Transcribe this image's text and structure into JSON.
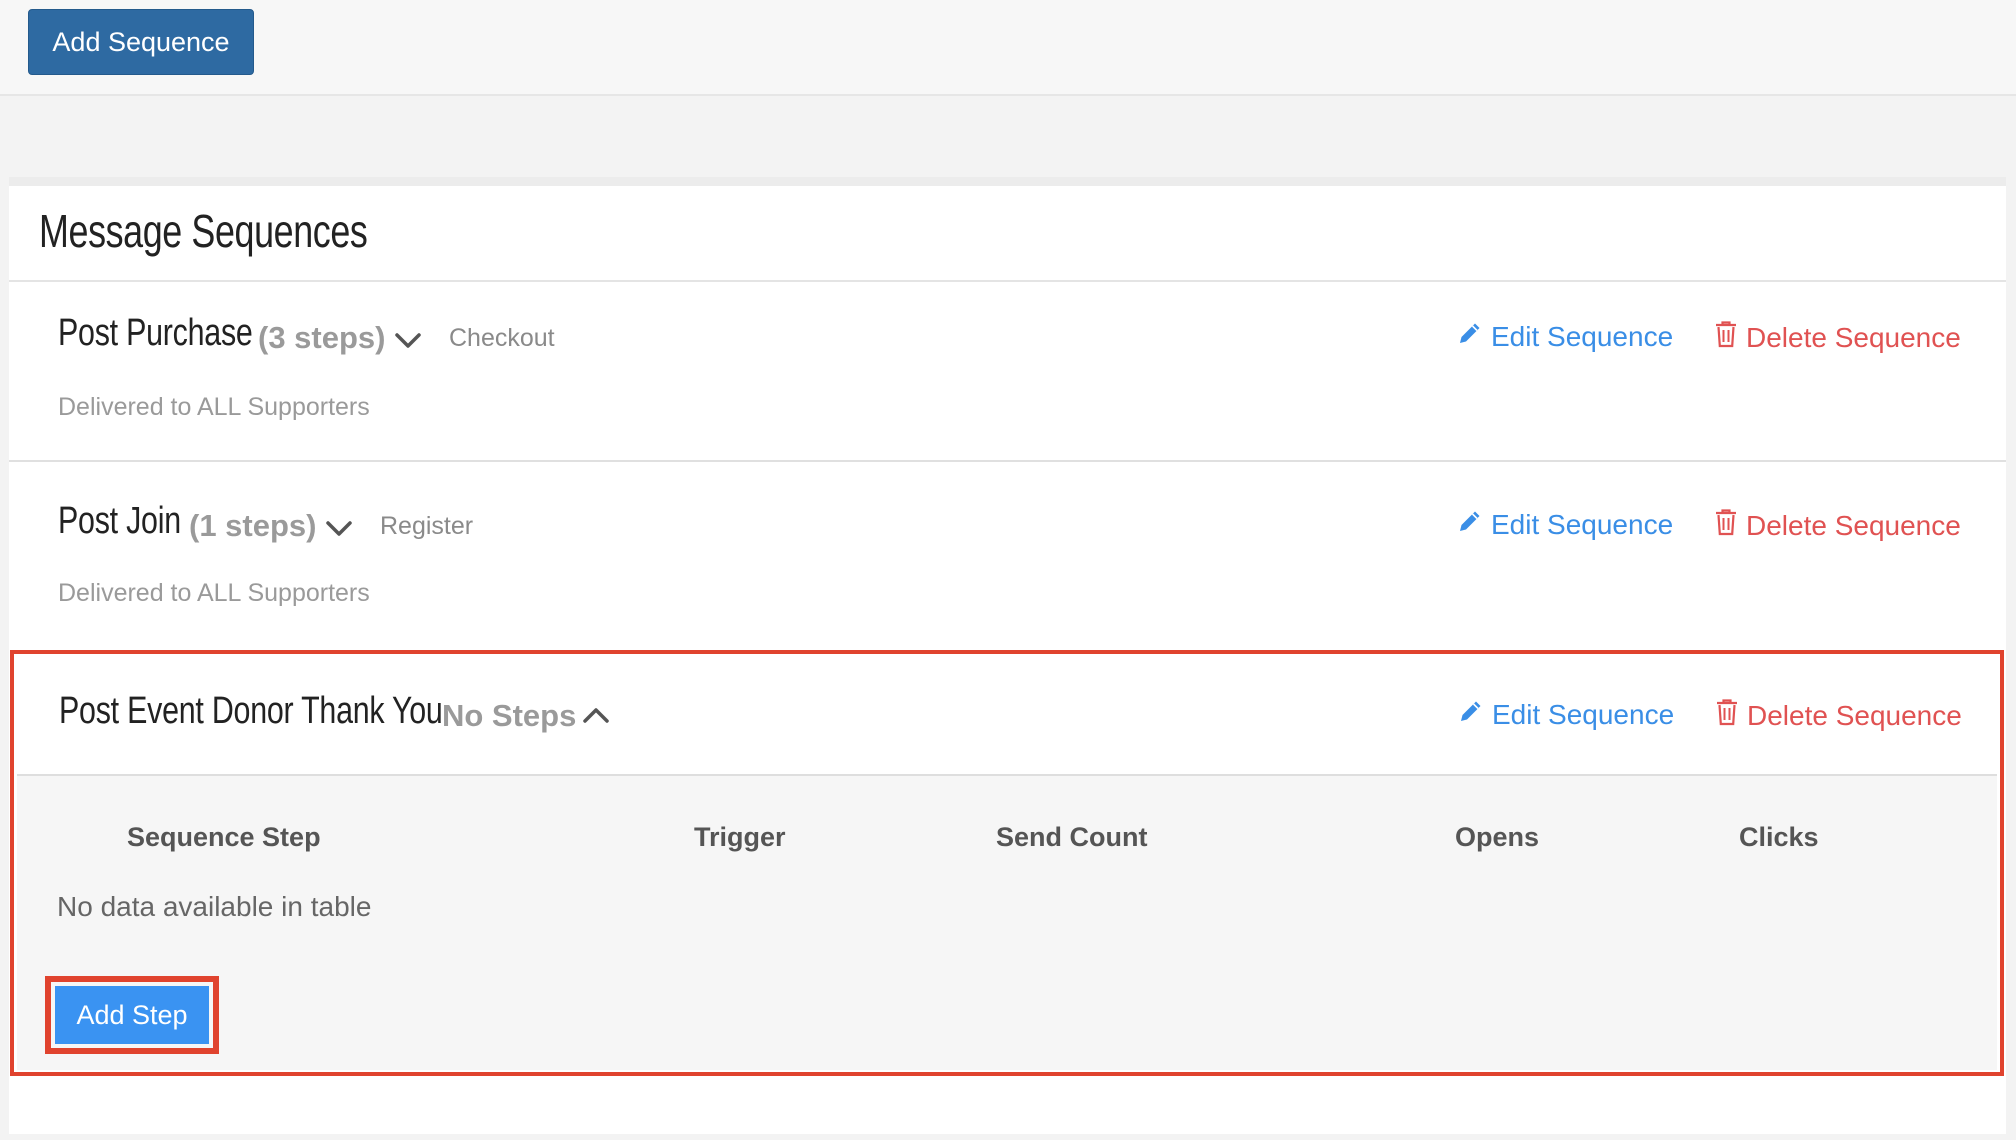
{
  "toolbar": {
    "add_sequence_label": "Add Sequence"
  },
  "panel": {
    "title": "Message Sequences"
  },
  "sequences": [
    {
      "name": "Post Purchase",
      "steps": "(3 steps)",
      "trigger": "Checkout",
      "delivered": "Delivered to ALL Supporters",
      "expanded": false,
      "edit_label": "Edit Sequence",
      "delete_label": "Delete Sequence"
    },
    {
      "name": "Post Join",
      "steps": "(1 steps)",
      "trigger": "Register",
      "delivered": "Delivered to ALL Supporters",
      "expanded": false,
      "edit_label": "Edit Sequence",
      "delete_label": "Delete Sequence"
    },
    {
      "name": "Post Event Donor Thank You",
      "steps": "No Steps",
      "expanded": true,
      "edit_label": "Edit Sequence",
      "delete_label": "Delete Sequence",
      "table": {
        "columns": [
          "Sequence Step",
          "Trigger",
          "Send Count",
          "Opens",
          "Clicks"
        ],
        "empty_message": "No data available in table"
      },
      "add_step_label": "Add Step"
    }
  ],
  "icons": {
    "edit": "pencil-icon",
    "delete": "trash-icon",
    "collapsed": "chevron-down-icon",
    "expanded": "chevron-up-icon"
  },
  "colors": {
    "primary_button": "#2e6aa2",
    "add_step_button": "#3a93f2",
    "edit_link": "#3a8ee6",
    "delete_link": "#e05252",
    "highlight": "#e0432e"
  }
}
